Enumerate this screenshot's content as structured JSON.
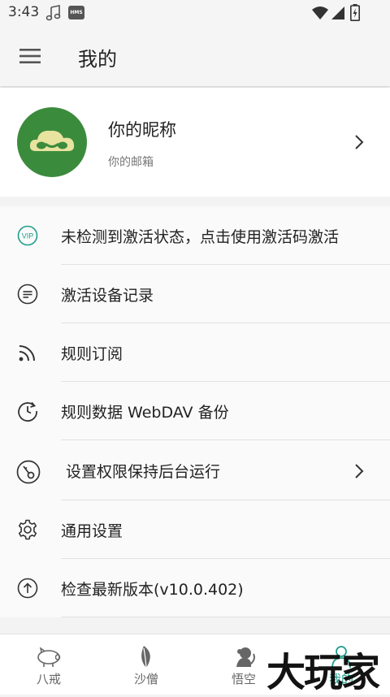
{
  "status_bar": {
    "time": "3:43",
    "hms_badge": "HMS"
  },
  "app_bar": {
    "title": "我的"
  },
  "profile": {
    "nickname": "你的昵称",
    "email": "你的邮箱"
  },
  "menu": {
    "items": [
      {
        "label": "未检测到激活状态，点击使用激活码激活",
        "icon": "vip-icon"
      },
      {
        "label": "激活设备记录",
        "icon": "list-icon"
      },
      {
        "label": "规则订阅",
        "icon": "rss-icon"
      },
      {
        "label": "规则数据 WebDAV 备份",
        "icon": "backup-clock-icon"
      },
      {
        "label": "设置权限保持后台运行",
        "icon": "key-icon"
      },
      {
        "label": "通用设置",
        "icon": "gear-icon"
      },
      {
        "label": "检查最新版本(v10.0.402)",
        "icon": "upload-icon"
      }
    ]
  },
  "bottom_nav": {
    "tabs": [
      {
        "label": "八戒",
        "icon": "pig-icon"
      },
      {
        "label": "沙僧",
        "icon": "leaf-icon"
      },
      {
        "label": "悟空",
        "icon": "monkey-icon"
      },
      {
        "label": "我的",
        "icon": "person-icon",
        "active": true
      }
    ]
  },
  "watermark": {
    "text": "大玩家"
  },
  "colors": {
    "accent": "#1e9e8c",
    "avatar_bg": "#3b8b3d",
    "avatar_cloud": "#e9e3a0"
  }
}
